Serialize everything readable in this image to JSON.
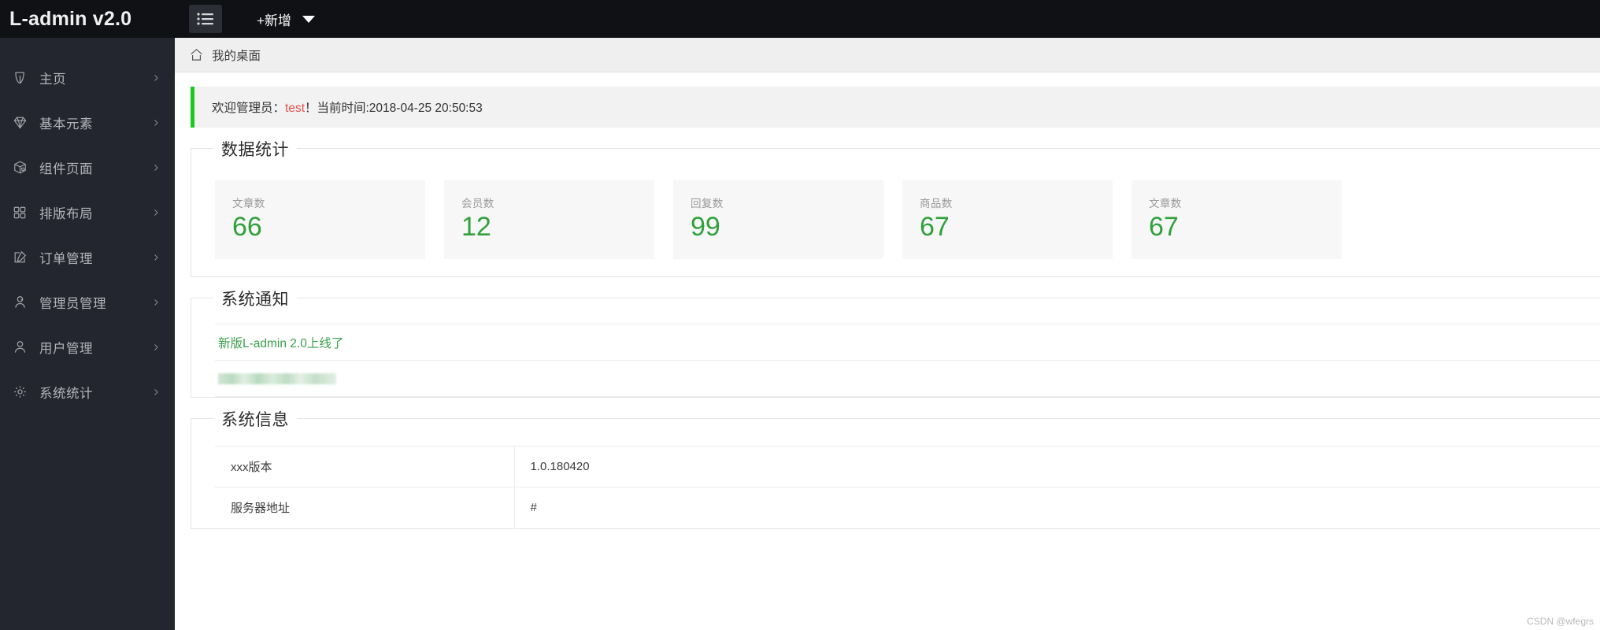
{
  "brand": {
    "title": "L-admin v2.0"
  },
  "topbar": {
    "menu_icon": "hamburger-list-icon",
    "add_label": "+新增",
    "caret_icon": "caret-down-icon"
  },
  "breadcrumb": {
    "home_icon": "home-icon",
    "current": "我的桌面"
  },
  "sidebar": {
    "items": [
      {
        "label": "主页",
        "icon": "leaf-icon",
        "arrow": "chevron-right-icon"
      },
      {
        "label": "基本元素",
        "icon": "diamond-icon",
        "arrow": "chevron-right-icon"
      },
      {
        "label": "组件页面",
        "icon": "cube-icon",
        "arrow": "chevron-right-icon"
      },
      {
        "label": "排版布局",
        "icon": "grid-icon",
        "arrow": "chevron-right-icon"
      },
      {
        "label": "订单管理",
        "icon": "edit-box-icon",
        "arrow": "chevron-right-icon"
      },
      {
        "label": "管理员管理",
        "icon": "user-gear-icon",
        "arrow": "chevron-right-icon"
      },
      {
        "label": "用户管理",
        "icon": "user-icon",
        "arrow": "chevron-right-icon"
      },
      {
        "label": "系统统计",
        "icon": "gear-icon",
        "arrow": "chevron-right-icon"
      }
    ]
  },
  "welcome": {
    "prefix": "欢迎管理员：",
    "user": "test",
    "suffix": "！当前时间:2018-04-25 20:50:53"
  },
  "stats": {
    "title": "数据统计",
    "cards": [
      {
        "label": "文章数",
        "value": "66"
      },
      {
        "label": "会员数",
        "value": "12"
      },
      {
        "label": "回复数",
        "value": "99"
      },
      {
        "label": "商品数",
        "value": "67"
      },
      {
        "label": "文章数",
        "value": "67"
      }
    ]
  },
  "notice": {
    "title": "系统通知",
    "items": [
      {
        "text": "新版L-admin 2.0上线了",
        "redacted": false
      },
      {
        "text": "",
        "redacted": true
      }
    ]
  },
  "sysinfo": {
    "title": "系统信息",
    "rows": [
      {
        "key": "xxx版本",
        "value": "1.0.180420"
      },
      {
        "key": "服务器地址",
        "value": "#"
      }
    ]
  },
  "watermark": {
    "text": "CSDN @wfegrs"
  },
  "colors": {
    "accent_green": "#30a13b",
    "banner_green": "#1aca1a",
    "link_green": "#38a04a",
    "user_red": "#e45050",
    "sidebar_bg": "#23262e",
    "topbar_bg": "#0f1115"
  }
}
